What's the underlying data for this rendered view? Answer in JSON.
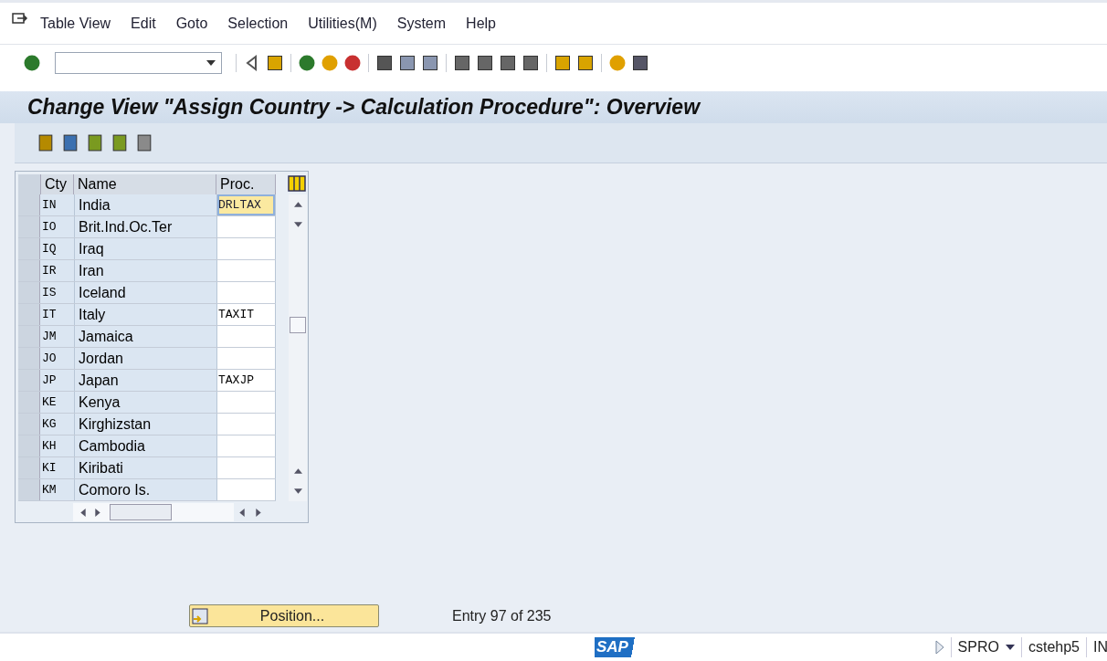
{
  "menu": [
    "Table View",
    "Edit",
    "Goto",
    "Selection",
    "Utilities(M)",
    "System",
    "Help"
  ],
  "title": "Change View \"Assign Country -> Calculation Procedure\": Overview",
  "table": {
    "columns": [
      "Cty",
      "Name",
      "Proc."
    ],
    "rows": [
      {
        "cty": "IN",
        "name": "India",
        "proc": "DRLTAX",
        "selected": true
      },
      {
        "cty": "IO",
        "name": "Brit.Ind.Oc.Ter",
        "proc": "",
        "selected": false
      },
      {
        "cty": "IQ",
        "name": "Iraq",
        "proc": "",
        "selected": false
      },
      {
        "cty": "IR",
        "name": "Iran",
        "proc": "",
        "selected": false
      },
      {
        "cty": "IS",
        "name": "Iceland",
        "proc": "",
        "selected": false
      },
      {
        "cty": "IT",
        "name": "Italy",
        "proc": "TAXIT",
        "selected": false
      },
      {
        "cty": "JM",
        "name": "Jamaica",
        "proc": "",
        "selected": false
      },
      {
        "cty": "JO",
        "name": "Jordan",
        "proc": "",
        "selected": false
      },
      {
        "cty": "JP",
        "name": "Japan",
        "proc": "TAXJP",
        "selected": false
      },
      {
        "cty": "KE",
        "name": "Kenya",
        "proc": "",
        "selected": false
      },
      {
        "cty": "KG",
        "name": "Kirghizstan",
        "proc": "",
        "selected": false
      },
      {
        "cty": "KH",
        "name": "Cambodia",
        "proc": "",
        "selected": false
      },
      {
        "cty": "KI",
        "name": "Kiribati",
        "proc": "",
        "selected": false
      },
      {
        "cty": "KM",
        "name": "Comoro Is.",
        "proc": "",
        "selected": false
      }
    ]
  },
  "position_button": "Position...",
  "entry_info": "Entry 97 of 235",
  "status_bar": {
    "logo": "SAP",
    "transaction": "SPRO",
    "system": "cstehp5",
    "mode": "IN"
  }
}
